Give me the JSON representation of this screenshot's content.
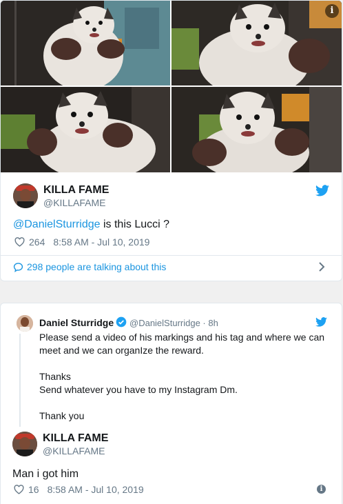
{
  "tweet1": {
    "media": {
      "info_glyph": "i",
      "icon": "info-icon"
    },
    "author": {
      "name": "KILLA FAME",
      "handle": "@KILLAFAME"
    },
    "mention": "@DanielSturridge",
    "text_rest": " is this Lucci ?",
    "likes": "264",
    "timestamp": "8:58 AM - Jul 10, 2019",
    "talking": "298 people are talking about this"
  },
  "tweet2": {
    "quoted": {
      "name": "Daniel Sturridge",
      "handle": "@DanielSturridge · 8h",
      "lines": [
        "Please send a video of his markings and his tag and where we can",
        "meet and we can organIze the reward.",
        "Thanks",
        "Send whatever you have to my Instagram Dm.",
        "Thank you"
      ]
    },
    "author": {
      "name": "KILLA FAME",
      "handle": "@KILLAFAME"
    },
    "text": "Man i got him",
    "likes": "16",
    "timestamp": "8:58 AM - Jul 10, 2019",
    "info_glyph": "i"
  },
  "colors": {
    "twitter_blue": "#1da1f2",
    "link_blue": "#1b95e0",
    "gray_text": "#657786",
    "border": "#e1e8ed"
  }
}
